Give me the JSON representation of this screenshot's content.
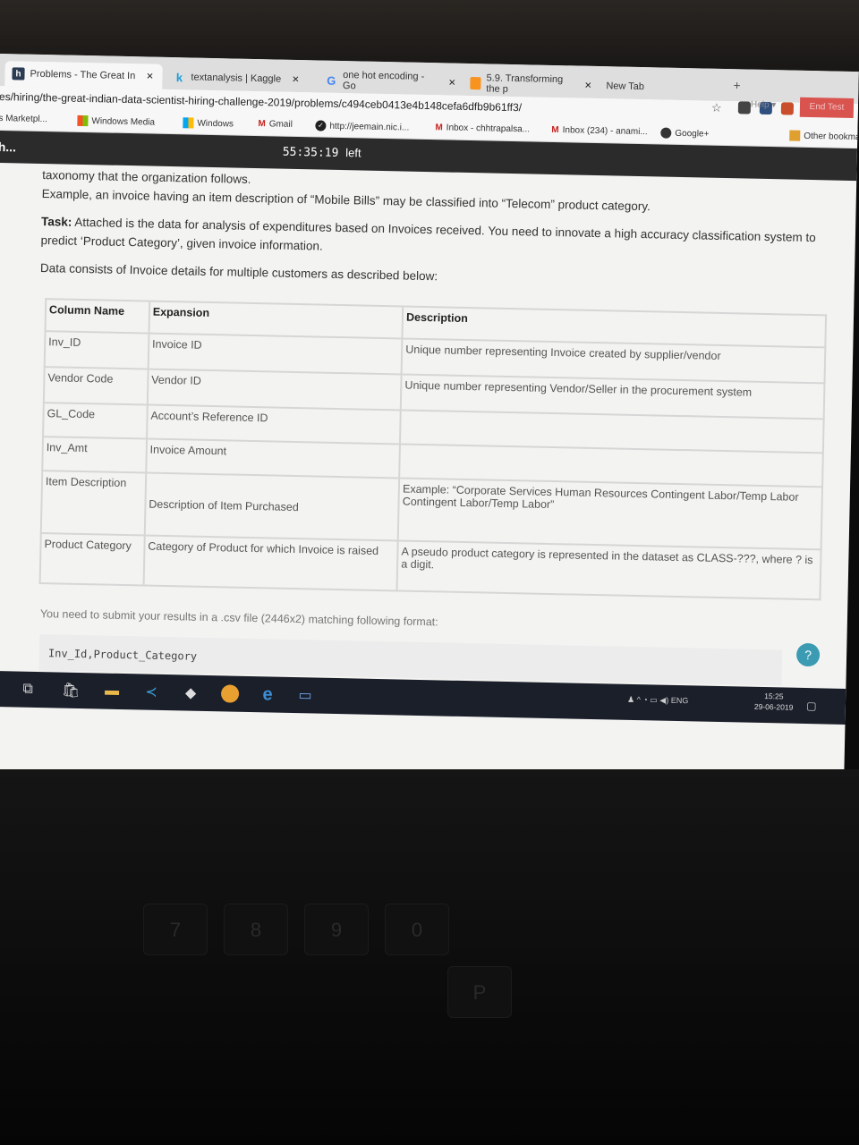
{
  "browser": {
    "tabs": [
      {
        "label": "Problems - The Great In",
        "icon": "hackerearth-icon",
        "color": "#2b3b53"
      },
      {
        "label": "textanalysis | Kaggle",
        "icon": "kaggle-icon",
        "color": "#1c9bd8"
      },
      {
        "label": "one hot encoding - Go",
        "icon": "google-icon",
        "color": "#4285f4"
      },
      {
        "label": "5.9. Transforming the p",
        "icon": "sklearn-icon",
        "color": "#f7931e"
      },
      {
        "label": "New Tab",
        "icon": "none",
        "color": "#999999"
      }
    ],
    "url": "es/hiring/the-great-indian-data-scientist-hiring-challenge-2019/problems/c494ceb0413e4b148cefa6dfb9b61ff3/",
    "bookmarks": [
      {
        "label": "s Marketpl...",
        "icon": "store-icon"
      },
      {
        "label": "Windows Media",
        "icon": "windows-icon"
      },
      {
        "label": "Windows",
        "icon": "windows-icon"
      },
      {
        "label": "Gmail",
        "icon": "gmail-icon"
      },
      {
        "label": "http://jeemain.nic.i...",
        "icon": "check-icon"
      },
      {
        "label": "Inbox - chhtrapalsa...",
        "icon": "gmail-icon"
      },
      {
        "label": "Inbox (234) - anami...",
        "icon": "gmail-icon"
      },
      {
        "label": "Google+",
        "icon": "google-plus-icon"
      },
      {
        "label": "Other bookmarks",
        "icon": "folder-icon"
      }
    ]
  },
  "header": {
    "title": "h...",
    "timer": "55:35:19",
    "timer_suffix": "left",
    "help_label": "Help",
    "end_test_label": "End Test"
  },
  "problem": {
    "line1": "taxonomy that the organization follows.",
    "line2": "Example, an invoice having an item description of “Mobile Bills” may be classified into “Telecom” product category.",
    "task_label": "Task:",
    "task_text": "Attached is the data for analysis of expenditures based on Invoices received. You need to innovate a high accuracy classification system to predict ‘Product Category’, given invoice information.",
    "data_intro": "Data consists of Invoice details for multiple customers as described below:"
  },
  "table": {
    "headers": [
      "Column Name",
      "Expansion",
      "Description"
    ],
    "rows": [
      [
        "Inv_ID",
        "Invoice ID",
        "Unique number representing Invoice created by supplier/vendor"
      ],
      [
        "Vendor Code",
        "Vendor ID",
        "Unique number representing Vendor/Seller in the procurement system"
      ],
      [
        "GL_Code",
        "Account’s Reference ID",
        ""
      ],
      [
        "Inv_Amt",
        "Invoice Amount",
        ""
      ],
      [
        "Item Description",
        "Description of Item Purchased",
        "Example: “Corporate Services Human Resources Contingent Labor/Temp Labor Contingent Labor/Temp Labor”"
      ],
      [
        "Product Category",
        "Category of Product for which Invoice is raised",
        "A pseudo product category is represented in the dataset as CLASS-???, where ? is a digit."
      ]
    ]
  },
  "submission": {
    "note": "You need to submit your results in a .csv file (2446x2) matching following format:",
    "code": "Inv_Id,Product_Category"
  },
  "taskbar": {
    "language": "ENG",
    "time": "15:25",
    "date": "29-06-2019"
  },
  "keyboard": {
    "keys": [
      "7",
      "8",
      "9",
      "0",
      "P"
    ]
  }
}
